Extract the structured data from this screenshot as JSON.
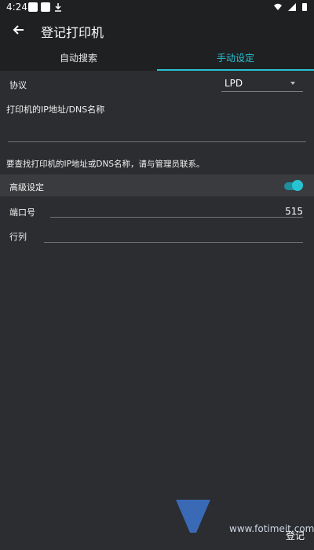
{
  "status_bar": {
    "time": "4:24"
  },
  "app_bar": {
    "title": "登记打印机"
  },
  "tabs": [
    {
      "label": "自动搜索",
      "active": false
    },
    {
      "label": "手动设定",
      "active": true
    }
  ],
  "form": {
    "protocol_label": "协议",
    "protocol_value": "LPD",
    "ip_label": "打印机的IP地址/DNS名称",
    "hint_text": "要查找打印机的IP地址或DNS名称，请与管理员联系。",
    "advanced_label": "高级设定",
    "advanced_enabled": true,
    "port_label": "端口号",
    "port_value": "515",
    "queue_label": "行列"
  },
  "watermark": {
    "text": "www.fotimeit.com"
  },
  "footer": {
    "register_label": "登记"
  },
  "colors": {
    "accent": "#27c3d3",
    "bg": "#2b2d30",
    "bar": "#1f2022"
  }
}
